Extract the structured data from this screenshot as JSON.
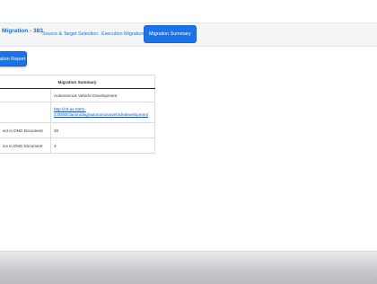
{
  "header": {
    "app_title": "Migration - 383",
    "tabs": [
      {
        "label": "Source & Target Selection",
        "active": false
      },
      {
        "label": "Execution Migration",
        "active": false
      },
      {
        "label": "Migration Summary",
        "active": true
      }
    ]
  },
  "actions": {
    "report_button": "ation Report"
  },
  "summary": {
    "heading": "Migration Summary",
    "rows": [
      {
        "label": "",
        "value": "Autonomous Vehicle Development"
      },
      {
        "label": "",
        "value": "http://clt-ax-0301-3.0000/clarion/dng/autonomousvehicledevelopment"
      },
      {
        "label": "ect in DNG Document",
        "value": "20"
      },
      {
        "label": "ice in DNG Document",
        "value": "3"
      }
    ]
  },
  "colors": {
    "accent": "#1a73e8",
    "link": "#1a55c8",
    "tabbar": "#f4f5f7"
  }
}
